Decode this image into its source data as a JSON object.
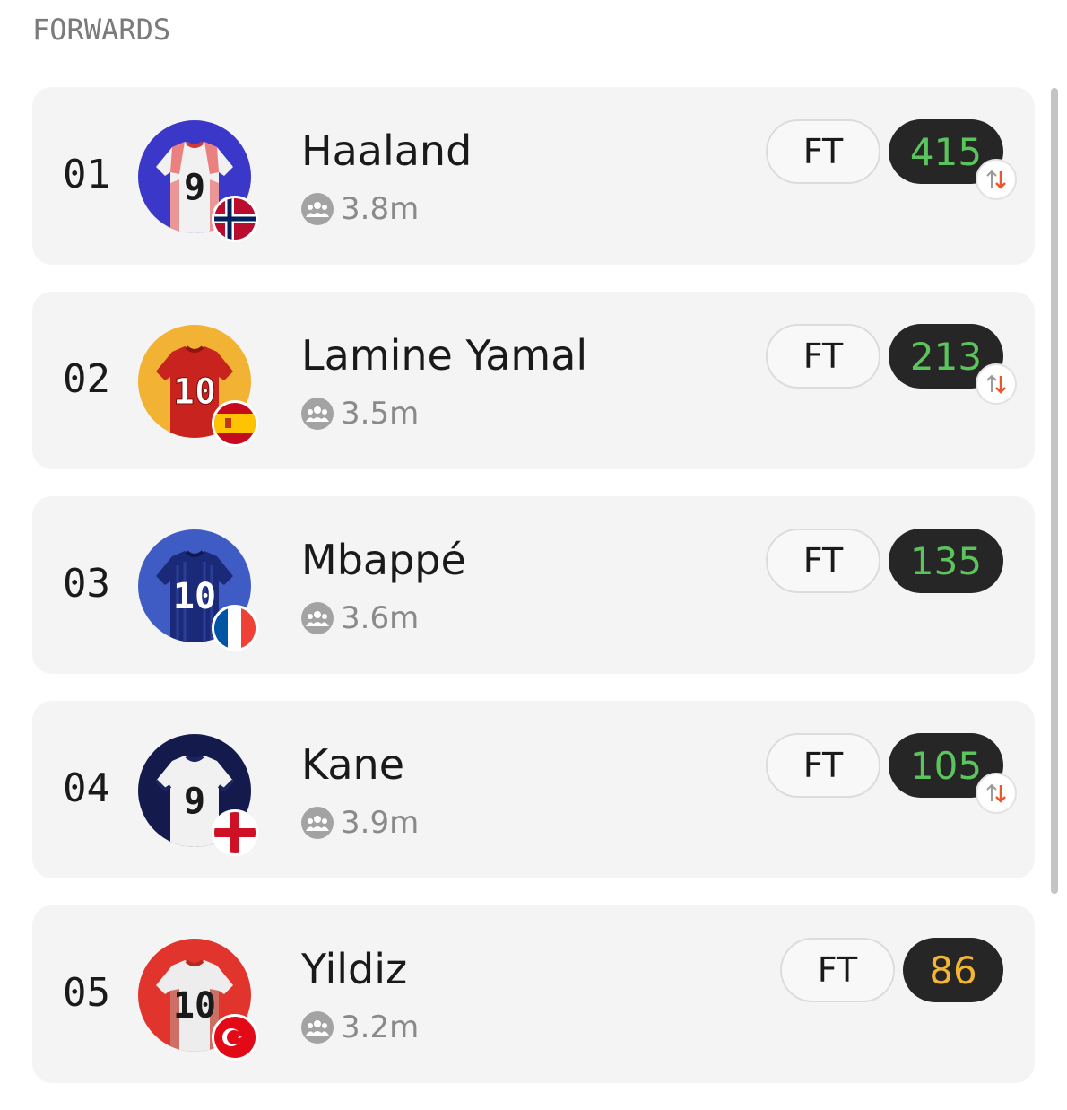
{
  "section": {
    "title": "FORWARDS"
  },
  "colors": {
    "score_green": "#5cc45c",
    "score_yellow": "#f2b633",
    "trend_down": "#e8582a"
  },
  "players": [
    {
      "rank": "01",
      "name": "Haaland",
      "followers": "3.8m",
      "status": "FT",
      "score": "415",
      "score_color": "#5cc45c",
      "trend_icon": "swap-down-icon",
      "has_trend": true,
      "flag": "norway-flag-icon",
      "kit": "white-red-kit",
      "kit_number": "9",
      "ring": "#3a37c9"
    },
    {
      "rank": "02",
      "name": "Lamine Yamal",
      "followers": "3.5m",
      "status": "FT",
      "score": "213",
      "score_color": "#5cc45c",
      "trend_icon": "swap-down-icon",
      "has_trend": true,
      "flag": "spain-flag-icon",
      "kit": "red-kit",
      "kit_number": "10",
      "ring": "#f2b233"
    },
    {
      "rank": "03",
      "name": "Mbappé",
      "followers": "3.6m",
      "status": "FT",
      "score": "135",
      "score_color": "#5cc45c",
      "trend_icon": "",
      "has_trend": false,
      "flag": "france-flag-icon",
      "kit": "navy-kit",
      "kit_number": "10",
      "ring": "#3f5cc4"
    },
    {
      "rank": "04",
      "name": "Kane",
      "followers": "3.9m",
      "status": "FT",
      "score": "105",
      "score_color": "#5cc45c",
      "trend_icon": "swap-down-icon",
      "has_trend": true,
      "flag": "england-flag-icon",
      "kit": "white-navy-kit",
      "kit_number": "9",
      "ring": "#141a4c"
    },
    {
      "rank": "05",
      "name": "Yildiz",
      "followers": "3.2m",
      "status": "FT",
      "score": "86",
      "score_color": "#f2b633",
      "trend_icon": "",
      "has_trend": false,
      "flag": "turkey-flag-icon",
      "kit": "white-red-trim-kit",
      "kit_number": "10",
      "ring": "#e0342c"
    }
  ]
}
